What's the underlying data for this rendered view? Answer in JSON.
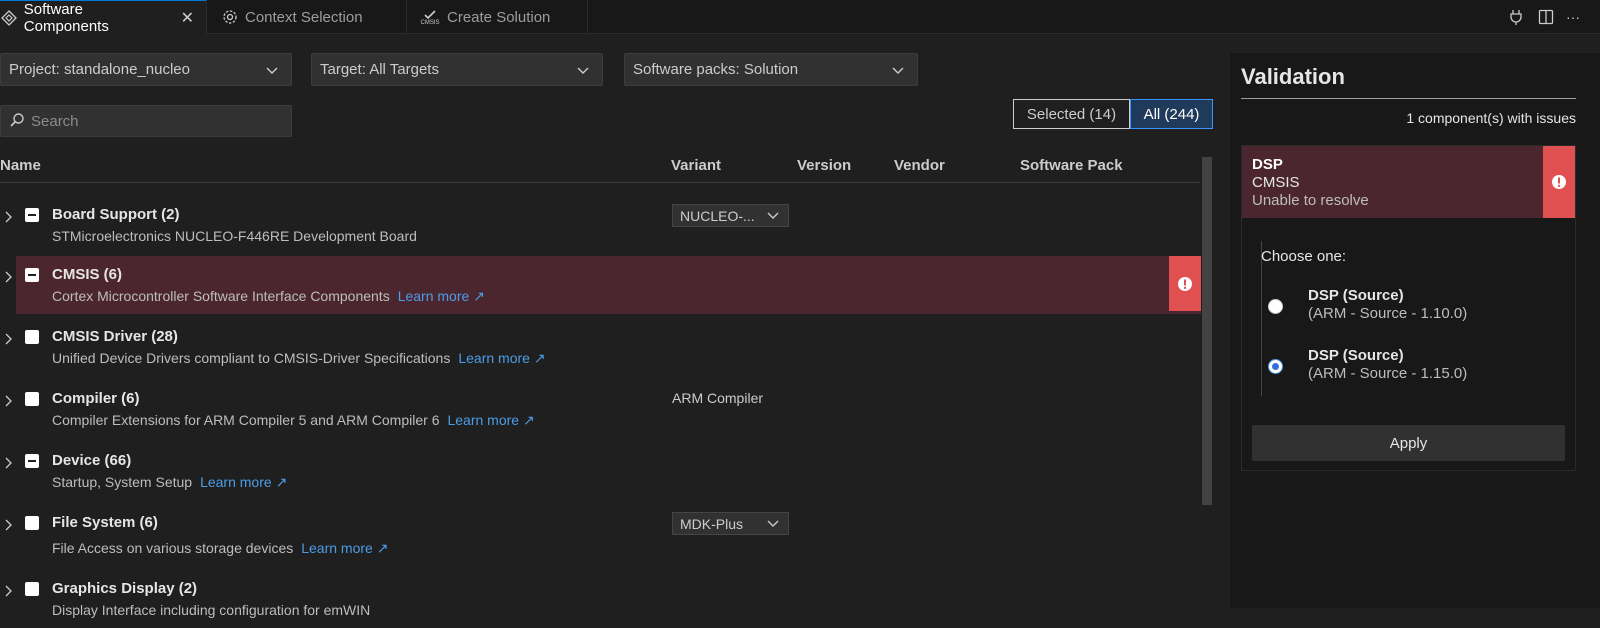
{
  "tabs": [
    {
      "label": "Software Components",
      "icon": "diamond-icon",
      "active": true
    },
    {
      "label": "Context Selection",
      "icon": "gear-icon"
    },
    {
      "label": "Create Solution",
      "icon": "cmsis-check-icon",
      "icon_text": "CMSIS"
    }
  ],
  "toolbar": {
    "icons": [
      "plug-icon",
      "split-editor-icon",
      "more-icon"
    ],
    "more_label": "···"
  },
  "filters": {
    "project": "Project: standalone_nucleo",
    "target": "Target: All Targets",
    "packs": "Software packs: Solution"
  },
  "search": {
    "placeholder": "Search",
    "value": ""
  },
  "toggle": {
    "selected": "Selected (14)",
    "all": "All (244)",
    "active": "all"
  },
  "columns": {
    "name": "Name",
    "variant": "Variant",
    "version": "Version",
    "vendor": "Vendor",
    "pack": "Software Pack"
  },
  "rows": [
    {
      "title": "Board Support (2)",
      "desc": "STMicroelectronics NUCLEO-F446RE Development Board",
      "check": "partial",
      "variant_select": "NUCLEO-..."
    },
    {
      "title": "CMSIS (6)",
      "desc": "Cortex Microcontroller Software Interface Components",
      "link": "Learn more",
      "check": "partial",
      "error": true
    },
    {
      "title": "CMSIS Driver (28)",
      "desc": "Unified Device Drivers compliant to CMSIS-Driver Specifications",
      "link": "Learn more",
      "check": "none"
    },
    {
      "title": "Compiler (6)",
      "desc": "Compiler Extensions for ARM Compiler 5 and ARM Compiler 6",
      "link": "Learn more",
      "check": "none",
      "variant": "ARM Compiler"
    },
    {
      "title": "Device (66)",
      "desc": "Startup, System Setup",
      "link": "Learn more",
      "check": "partial"
    },
    {
      "title": "File System (6)",
      "desc": "File Access on various storage devices",
      "link": "Learn more",
      "check": "none",
      "variant_select": "MDK-Plus"
    },
    {
      "title": "Graphics Display (2)",
      "desc": "Display Interface including configuration for emWIN",
      "check": "none"
    }
  ],
  "validation": {
    "title": "Validation",
    "issues": "1 component(s) with issues",
    "card": {
      "name": "DSP",
      "group": "CMSIS",
      "status": "Unable to resolve",
      "choose": "Choose one:",
      "options": [
        {
          "title": "DSP (Source)",
          "detail": "(ARM - Source - 1.10.0)",
          "selected": false
        },
        {
          "title": "DSP (Source)",
          "detail": "(ARM - Source - 1.15.0)",
          "selected": true
        }
      ],
      "apply": "Apply"
    }
  },
  "colors": {
    "accent": "#0078d4",
    "error_bg": "#4b262f",
    "error_badge": "#e05050",
    "link": "#4c9ce6"
  }
}
